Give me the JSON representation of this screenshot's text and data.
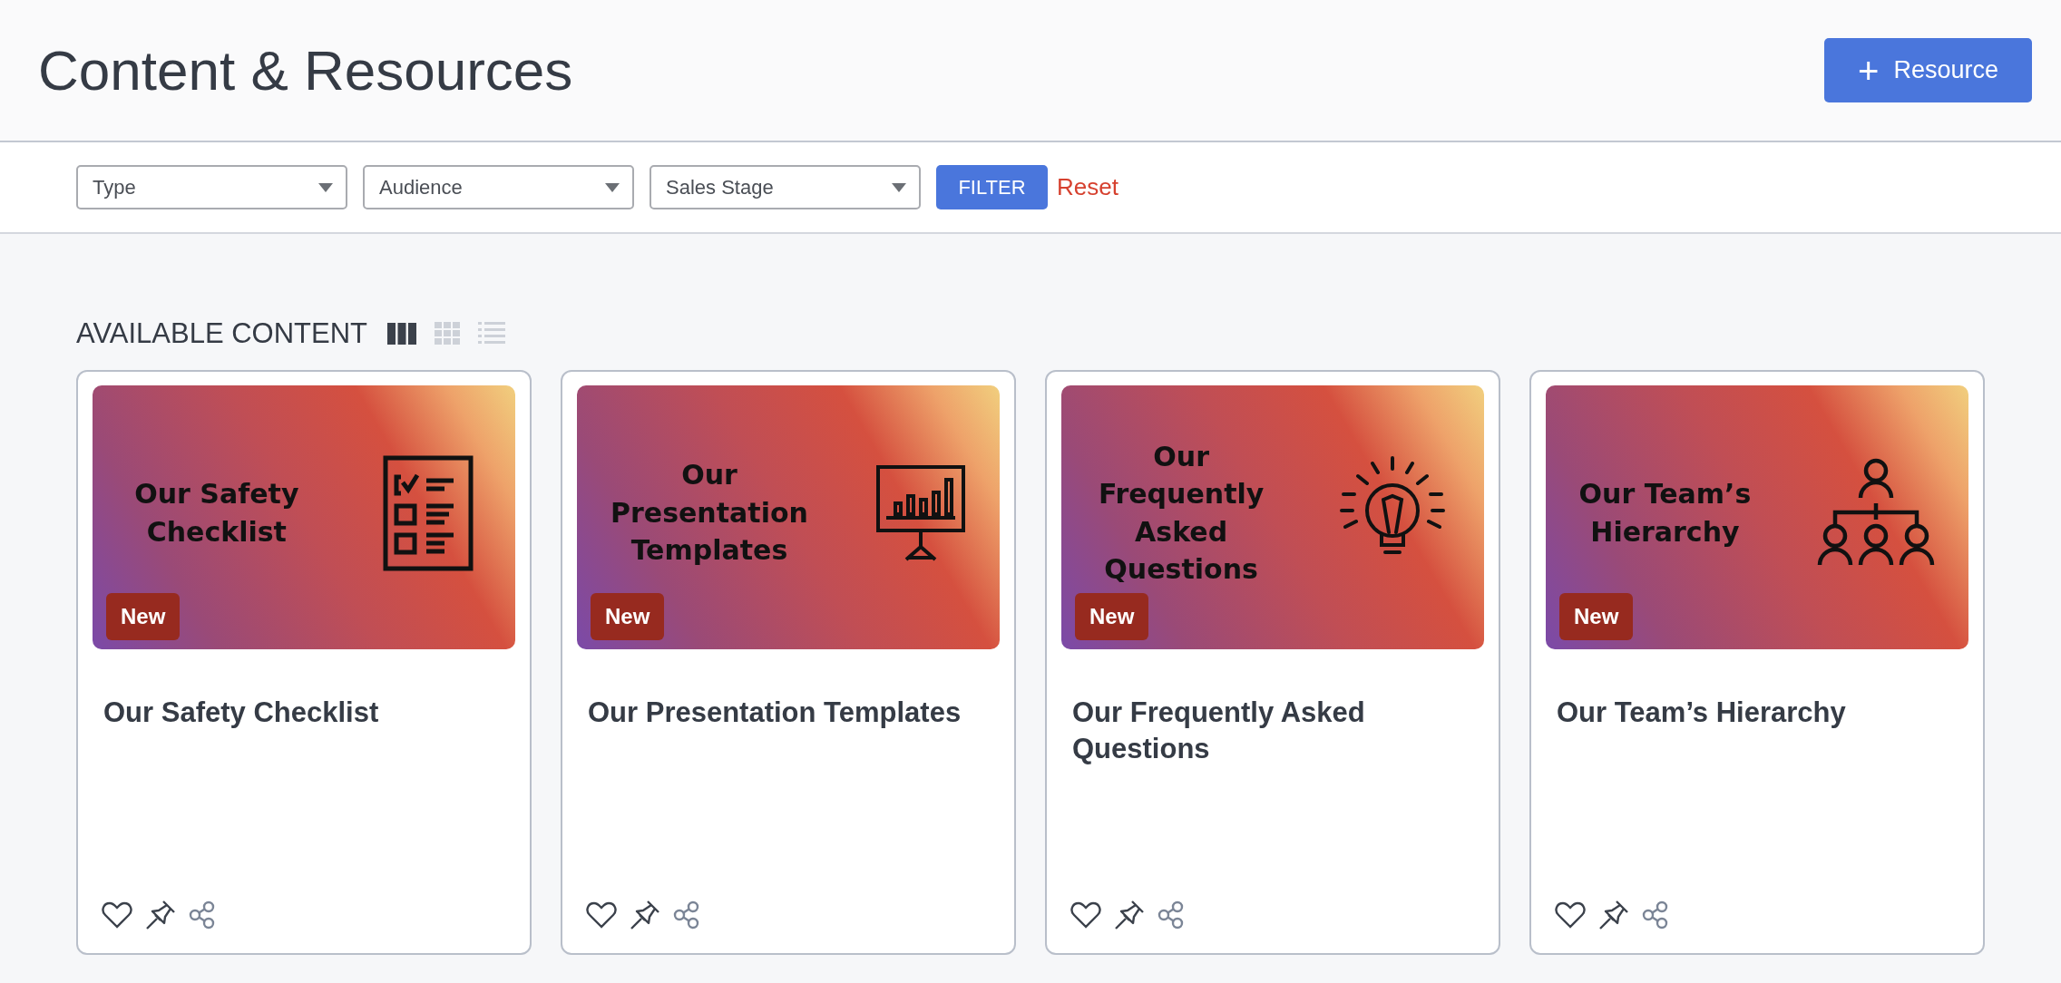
{
  "page": {
    "title": "Content & Resources",
    "add_button": {
      "icon": "+",
      "label": "Resource"
    }
  },
  "filters": {
    "selects": [
      {
        "placeholder": "Type"
      },
      {
        "placeholder": "Audience"
      },
      {
        "placeholder": "Sales Stage"
      }
    ],
    "filter_button": "FILTER",
    "reset_link": "Reset"
  },
  "section": {
    "title": "AVAILABLE CONTENT",
    "views": [
      {
        "kind": "columns",
        "selected": true
      },
      {
        "kind": "grid",
        "selected": false
      },
      {
        "kind": "list",
        "selected": false
      }
    ]
  },
  "cards": [
    {
      "banner_lines": [
        "Our Safety",
        "Checklist"
      ],
      "kind": "checklist",
      "badge": "New",
      "title": "Our Safety Checklist"
    },
    {
      "banner_lines": [
        "Our",
        "Presentation",
        "Templates"
      ],
      "kind": "presentation",
      "badge": "New",
      "title": "Our Presentation Templates"
    },
    {
      "banner_lines": [
        "Our",
        "Frequently",
        "Asked",
        "Questions"
      ],
      "kind": "lightbulb",
      "badge": "New",
      "title": "Our Frequently Asked Questions"
    },
    {
      "banner_lines": [
        "Our Team’s",
        "Hierarchy"
      ],
      "kind": "hierarchy",
      "badge": "New",
      "title": "Our Team’s Hierarchy"
    }
  ]
}
